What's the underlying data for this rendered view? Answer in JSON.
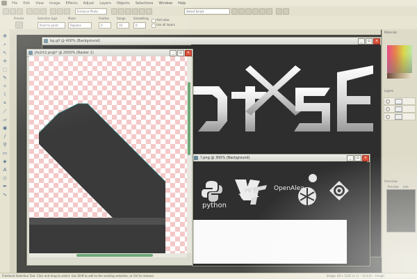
{
  "menubar": {
    "items": [
      "File",
      "Edit",
      "View",
      "Image",
      "Effects",
      "Adjust",
      "Layers",
      "Objects",
      "Selections",
      "Window",
      "Help"
    ]
  },
  "toolbar": {
    "script_select": "Select Script",
    "enhance_photo": "Enhance Photo"
  },
  "tool_options": {
    "presets_label": "Presets",
    "selection_type_label": "Selection type",
    "selection_type_value": "Point to point",
    "mode_label": "Mode",
    "mode_value": "Replace",
    "feather_label": "Feather",
    "feather_value": "0",
    "range_label": "Range",
    "range_value": "10",
    "smoothing_label": "Smoothing",
    "smoothing_value": "0",
    "antialias_label": "Anti-alias",
    "use_all_layers_label": "Use all layers"
  },
  "windows": {
    "bg_window": {
      "title": "bg.gif @ 400% (Background)"
    },
    "zoom_window": {
      "title": "[fe2rt2.pngt* @ 2000% (Raster 1)"
    },
    "logos_window": {
      "title": "?.png @ 300% (Background)"
    }
  },
  "logos": {
    "python": "python",
    "vtk": "vtk",
    "openalea": "OpenAlea"
  },
  "panels": {
    "materials": "Materials",
    "layers": "Layers",
    "overview": "Overview",
    "overview_tab_preview": "Preview",
    "overview_tab_info": "Info"
  },
  "statusbar": {
    "text": "Freehand Selection Tool: Click and drag to select. Use Shift to add to the existing selection, or Ctrl to remove.",
    "coords": "Image: 40 x 1245 (x 1) -- (0,0,0) -- Image:"
  },
  "colors": {
    "accent": "#6fa878",
    "close": "#d9503a",
    "checker": "#f4c8c8"
  }
}
